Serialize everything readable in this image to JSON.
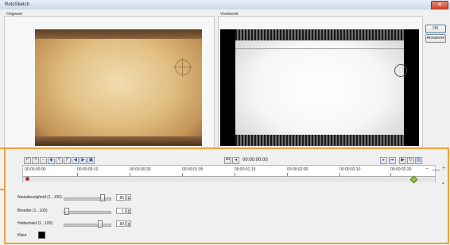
{
  "window": {
    "title": "RotoSketch",
    "close_glyph": "✕"
  },
  "panels": {
    "original_label": "Origineel",
    "preview_label": "Voorbeeld"
  },
  "buttons": {
    "ok": "OK",
    "cancel": "Annuleren"
  },
  "toolbar": {
    "icons": [
      "undo-icon",
      "redo-icon",
      "clear-icon",
      "select-icon",
      "curve-left-icon",
      "curve-right-icon",
      "keyframe-left-icon",
      "keyframe-right-icon",
      "frame-icon"
    ]
  },
  "transport": {
    "timecode": "00:00:00:00",
    "prev_icon": "skip-start-icon",
    "prev_frame_icon": "step-back-icon",
    "next_frame_icon": "step-forward-icon",
    "next_icon": "skip-end-icon",
    "play_icon": "play-icon",
    "loop_icon": "loop-icon",
    "view_icon": "view-icon"
  },
  "timeline": {
    "labels": [
      "00:00:00:00",
      "00:00:00:10",
      "00:00:00:20",
      "00:00:01:05",
      "00:00:01:15",
      "00:00:02:00",
      "00:00:02:10",
      "00:00:02:20"
    ],
    "zoom_minus": "−",
    "zoom_plus": "+"
  },
  "settings": {
    "accuracy": {
      "label": "Nauwkeurigheid (1...100)",
      "value": "85",
      "fraction": 0.85
    },
    "width": {
      "label": "Breedte (1...100)",
      "value": "1",
      "fraction": 0.01
    },
    "brightness": {
      "label": "Helderheid (1...100)",
      "value": "80",
      "fraction": 0.8
    },
    "color": {
      "label": "Kleur",
      "value": "#000000"
    }
  },
  "colors": {
    "accent": "#f2a23a",
    "playhead": "#b0302a",
    "keyframe": "#8dc63f"
  }
}
